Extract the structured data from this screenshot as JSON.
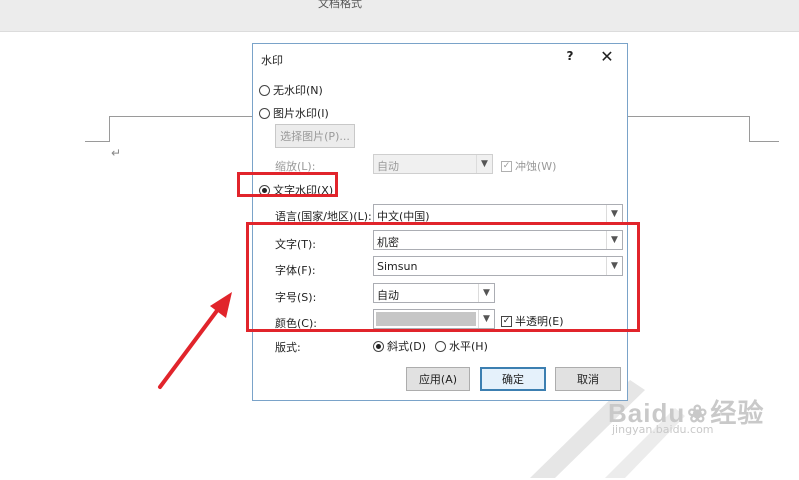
{
  "window": {
    "title_partial": "文档格式"
  },
  "document": {
    "para_mark": "↵"
  },
  "dialog": {
    "title": "水印",
    "help": "?",
    "close": "✕",
    "no_watermark": "无水印(N)",
    "picture_watermark": "图片水印(I)",
    "select_picture_button": "选择图片(P)...",
    "scale_label": "缩放(L):",
    "scale_value": "自动",
    "washout_label": "冲蚀(W)",
    "text_watermark": "文字水印(X)",
    "language_label": "语言(国家/地区)(L):",
    "language_value": "中文(中国)",
    "text_label": "文字(T):",
    "text_value": "机密",
    "font_label": "字体(F):",
    "font_value": "Simsun",
    "size_label": "字号(S):",
    "size_value": "自动",
    "color_label": "颜色(C):",
    "semitransparent_label": "半透明(E)",
    "layout_label": "版式:",
    "diagonal_label": "斜式(D)",
    "horizontal_label": "水平(H)",
    "apply_button": "应用(A)",
    "ok_button": "确定",
    "cancel_button": "取消"
  },
  "watermark": {
    "brand": "Baidu",
    "brand_cn": "经验",
    "url": "jingyan.baidu.com"
  },
  "colors": {
    "highlight": "#e1242b",
    "dialog_border": "#7aa3c9",
    "swatch": "#c6c6c6"
  },
  "icons": [
    "chevron-down-icon",
    "checkmark-icon",
    "close-icon",
    "help-icon",
    "paw-icon",
    "arrow-icon"
  ]
}
